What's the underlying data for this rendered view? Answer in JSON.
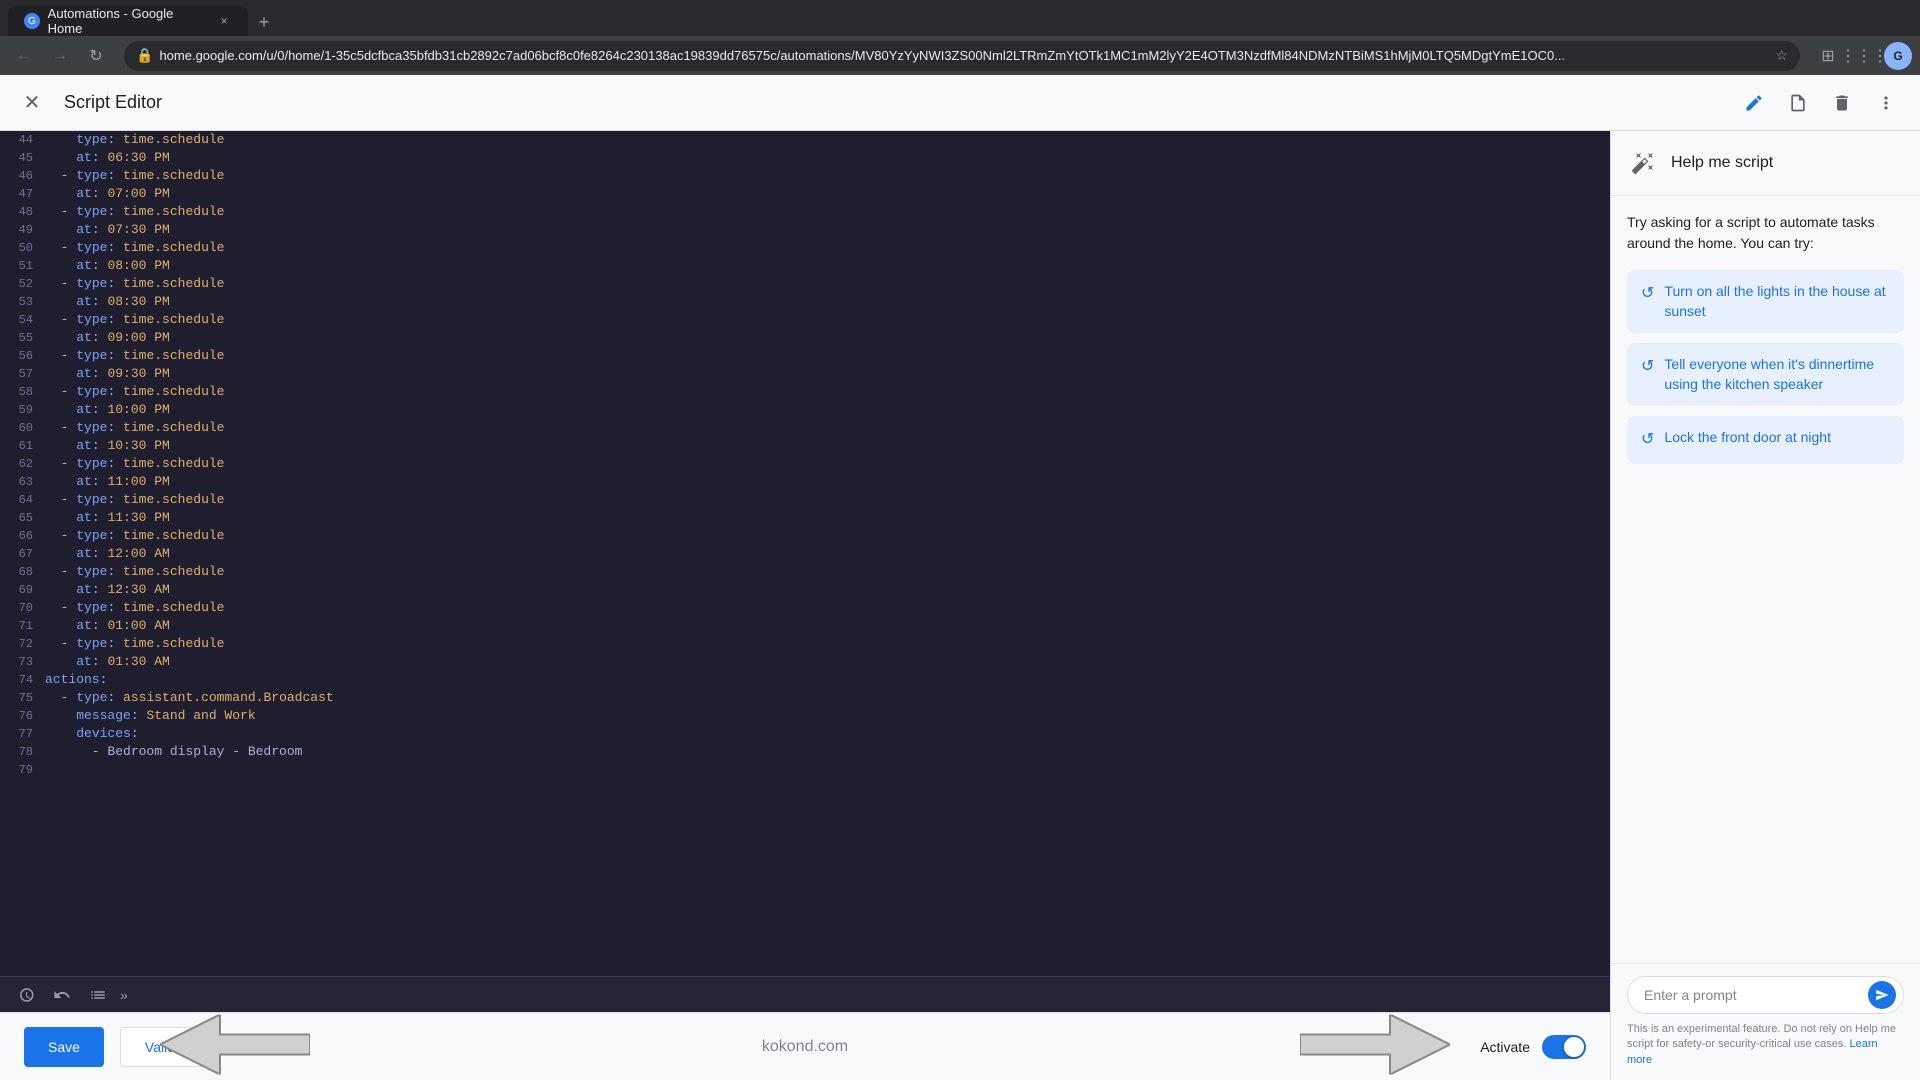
{
  "browser": {
    "tab": {
      "favicon_text": "G",
      "title": "Automations - Google Home",
      "close_label": "×"
    },
    "new_tab_label": "+",
    "address": "home.google.com/u/0/home/1-35c5dcfbca35bfdb31cb2892c7ad06bcf8c0fe8264c230138ac19839dd76575c/automations/MV80YzYyNWI3ZS00Nml2LTRmZmYtOTk1MC1mM2lyY2E4OTM3NzdfMl84NDMzNTBiMS1hMjM0LTQ5MDgtYmE1OC0...",
    "nav": {
      "back_label": "←",
      "forward_label": "→",
      "reload_label": "↻",
      "home_label": "⌂"
    }
  },
  "app": {
    "header": {
      "close_label": "×",
      "title": "Script Editor",
      "edit_icon": "✏",
      "doc_icon": "📄",
      "delete_icon": "🗑",
      "more_icon": "⋮"
    }
  },
  "editor": {
    "lines": [
      {
        "num": 44,
        "code": "    type: time.schedule"
      },
      {
        "num": 45,
        "code": "    at: 06:30 PM"
      },
      {
        "num": 46,
        "code": "  - type: time.schedule"
      },
      {
        "num": 47,
        "code": "    at: 07:00 PM"
      },
      {
        "num": 48,
        "code": "  - type: time.schedule"
      },
      {
        "num": 49,
        "code": "    at: 07:30 PM"
      },
      {
        "num": 50,
        "code": "  - type: time.schedule"
      },
      {
        "num": 51,
        "code": "    at: 08:00 PM"
      },
      {
        "num": 52,
        "code": "  - type: time.schedule"
      },
      {
        "num": 53,
        "code": "    at: 08:30 PM"
      },
      {
        "num": 54,
        "code": "  - type: time.schedule"
      },
      {
        "num": 55,
        "code": "    at: 09:00 PM"
      },
      {
        "num": 56,
        "code": "  - type: time.schedule"
      },
      {
        "num": 57,
        "code": "    at: 09:30 PM"
      },
      {
        "num": 58,
        "code": "  - type: time.schedule"
      },
      {
        "num": 59,
        "code": "    at: 10:00 PM"
      },
      {
        "num": 60,
        "code": "  - type: time.schedule"
      },
      {
        "num": 61,
        "code": "    at: 10:30 PM"
      },
      {
        "num": 62,
        "code": "  - type: time.schedule"
      },
      {
        "num": 63,
        "code": "    at: 11:00 PM"
      },
      {
        "num": 64,
        "code": "  - type: time.schedule"
      },
      {
        "num": 65,
        "code": "    at: 11:30 PM"
      },
      {
        "num": 66,
        "code": "  - type: time.schedule"
      },
      {
        "num": 67,
        "code": "    at: 12:00 AM"
      },
      {
        "num": 68,
        "code": "  - type: time.schedule"
      },
      {
        "num": 69,
        "code": "    at: 12:30 AM"
      },
      {
        "num": 70,
        "code": "  - type: time.schedule"
      },
      {
        "num": 71,
        "code": "    at: 01:00 AM"
      },
      {
        "num": 72,
        "code": "  - type: time.schedule"
      },
      {
        "num": 73,
        "code": "    at: 01:30 AM"
      },
      {
        "num": 74,
        "code": "actions:"
      },
      {
        "num": 75,
        "code": "  - type: assistant.command.Broadcast"
      },
      {
        "num": 76,
        "code": "    message: Stand and Work"
      },
      {
        "num": 77,
        "code": "    devices:"
      },
      {
        "num": 78,
        "code": "      - Bedroom display - Bedroom"
      },
      {
        "num": 79,
        "code": ""
      }
    ],
    "toolbar": {
      "history_icon": "🕐",
      "undo_icon": "↩",
      "list_icon": "☰",
      "more_label": "»"
    }
  },
  "action_bar": {
    "save_label": "Save",
    "validate_label": "Validate",
    "watermark": "kokond.com",
    "activate_label": "Activate"
  },
  "right_panel": {
    "header": {
      "title": "Help me script"
    },
    "intro": "Try asking for a script to automate tasks around the home. You can try:",
    "suggestions": [
      {
        "id": "suggestion-1",
        "text": "Turn on all the lights in the house at sunset"
      },
      {
        "id": "suggestion-2",
        "text": "Tell everyone when it's dinnertime using the kitchen speaker"
      },
      {
        "id": "suggestion-3",
        "text": "Lock the front door at night"
      }
    ],
    "prompt_placeholder": "Enter a prompt",
    "disclaimer": "This is an experimental feature. Do not rely on Help me script for safety-or security-critical use cases.",
    "learn_more": "Learn more"
  }
}
